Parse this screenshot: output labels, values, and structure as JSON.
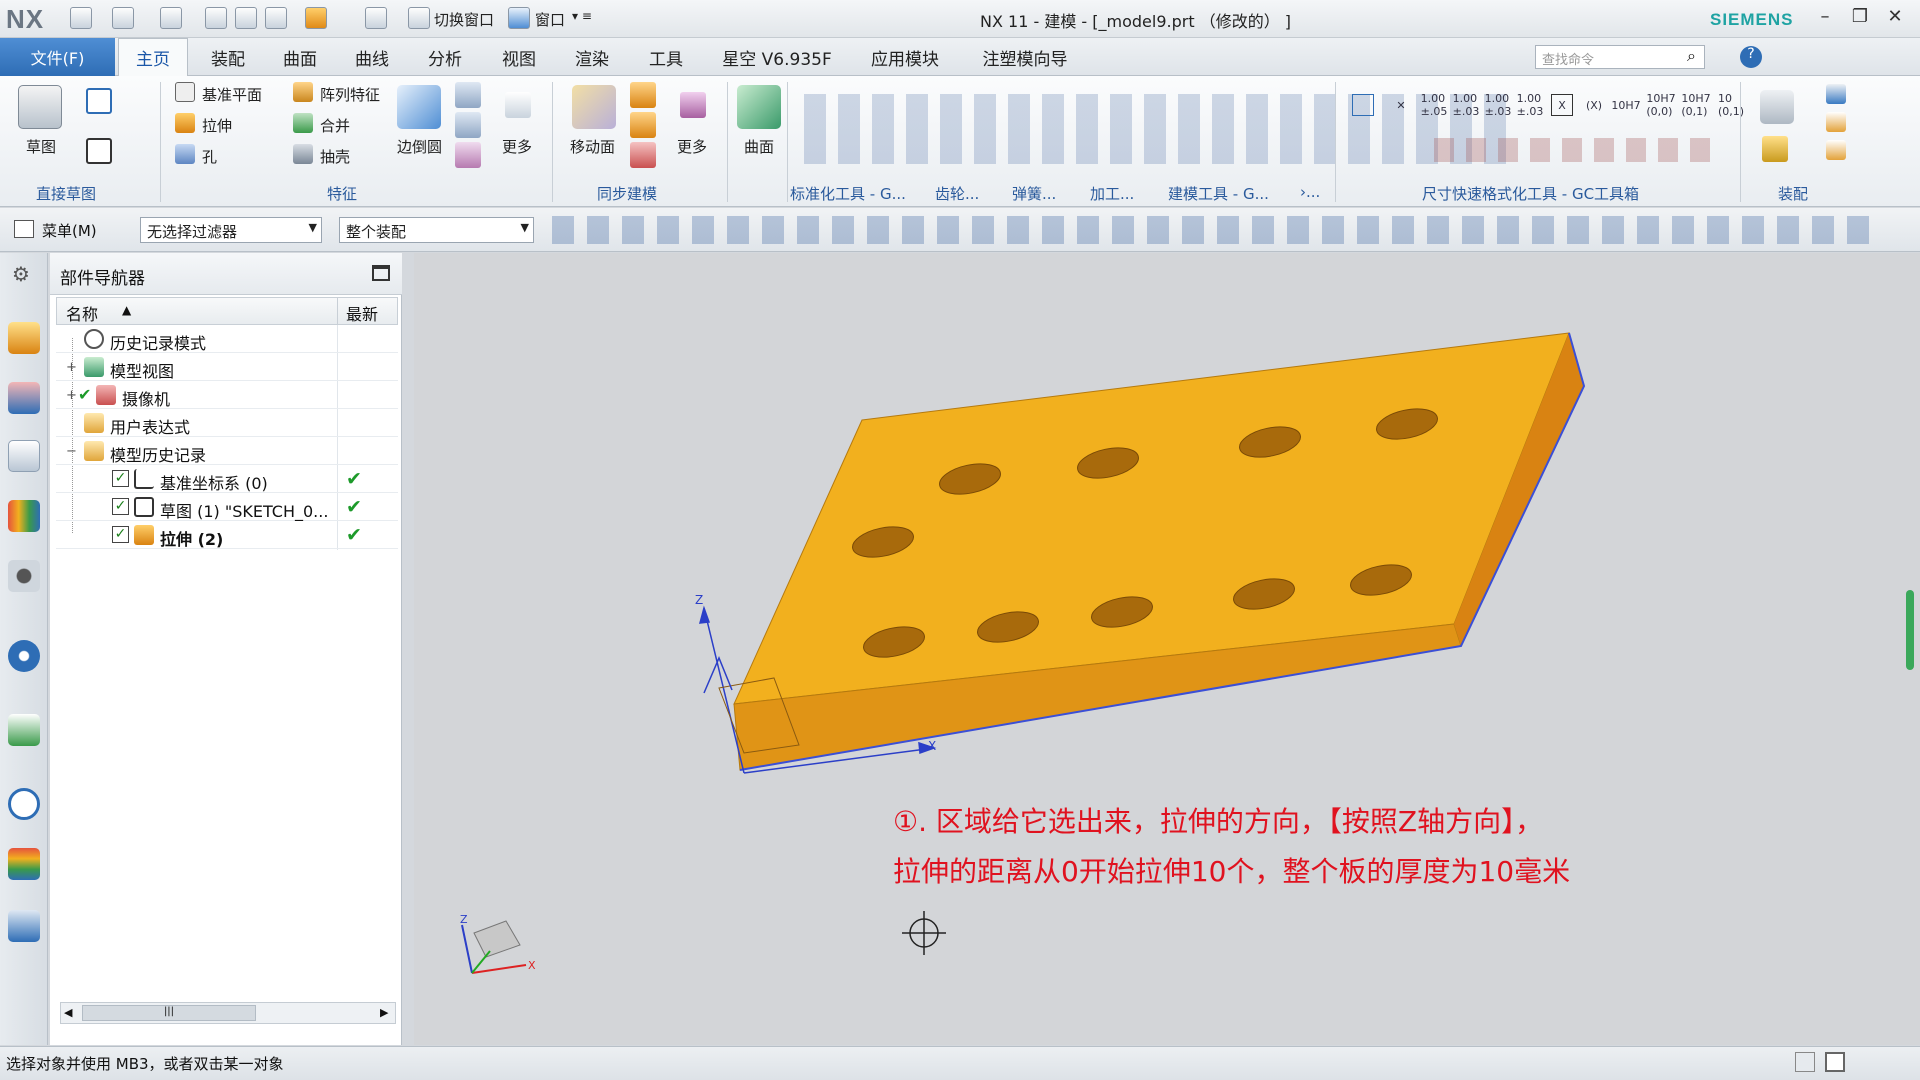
{
  "app": {
    "logo": "NX",
    "window_title": "NX 11 - 建模 - [_model9.prt （修改的） ]",
    "brand": "SIEMENS"
  },
  "quick_access": {
    "switch_window": "切换窗口",
    "window": "窗口"
  },
  "menu_tabs": [
    "文件(F)",
    "主页",
    "装配",
    "曲面",
    "曲线",
    "分析",
    "视图",
    "渲染",
    "工具",
    "星空 V6.935F",
    "应用模块",
    "注塑模向导"
  ],
  "active_tab": "主页",
  "search": {
    "placeholder": "查找命令"
  },
  "ribbon": {
    "direct_sketch": {
      "sketch": "草图",
      "group": "直接草图"
    },
    "feature": {
      "datum_plane": "基准平面",
      "extrude": "拉伸",
      "hole": "孔",
      "pattern": "阵列特征",
      "unite": "合并",
      "shell": "抽壳",
      "edge_blend": "边倒圆",
      "more": "更多",
      "group": "特征"
    },
    "sync": {
      "move_face": "移动面",
      "more": "更多",
      "group": "同步建模"
    },
    "surface": {
      "surface": "曲面"
    },
    "groups_right": [
      "标准化工具 - G...",
      "齿轮...",
      "弹簧...",
      "加工...",
      "建模工具 - G...",
      "›..."
    ],
    "dim_group": "尺寸快速格式化工具 - GC工具箱",
    "dim_labels": [
      "1.00 ±.05",
      "1.00 ±.03",
      "1.00 ±.03",
      "1.00 ±.03",
      "(X)",
      "10H7",
      "10H7 (0,0)",
      "10H7 (0,1)",
      "10 (0,1)"
    ],
    "assembly_group": "装配"
  },
  "selection_bar": {
    "menu": "菜单(M)",
    "filter": "无选择过滤器",
    "scope": "整个装配"
  },
  "navigator": {
    "title": "部件导航器",
    "col_name": "名称",
    "col_latest": "最新",
    "rows": [
      {
        "label": "历史记录模式",
        "indent": 1
      },
      {
        "label": "模型视图",
        "indent": 1
      },
      {
        "label": "摄像机",
        "indent": 1
      },
      {
        "label": "用户表达式",
        "indent": 1
      },
      {
        "label": "模型历史记录",
        "indent": 1
      },
      {
        "label": "基准坐标系 (0)",
        "indent": 2
      },
      {
        "label": "草图 (1) \"SKETCH_0...",
        "indent": 2
      },
      {
        "label": "拉伸 (2)",
        "indent": 2
      }
    ]
  },
  "annotation": {
    "line1": "①. 区域给它选出来，拉伸的方向，【按照Z轴方向】，",
    "line2": "拉伸的距离从0开始拉伸10个，整个板的厚度为10毫米"
  },
  "axes": {
    "z": "Z",
    "x": "X"
  },
  "status": {
    "text": "选择对象并使用 MB3，或者双击某一对象"
  },
  "colors": {
    "plate_top": "#f2b01e",
    "plate_side": "#d88712",
    "accent": "#2e6db5",
    "annotation": "#e0121f"
  }
}
